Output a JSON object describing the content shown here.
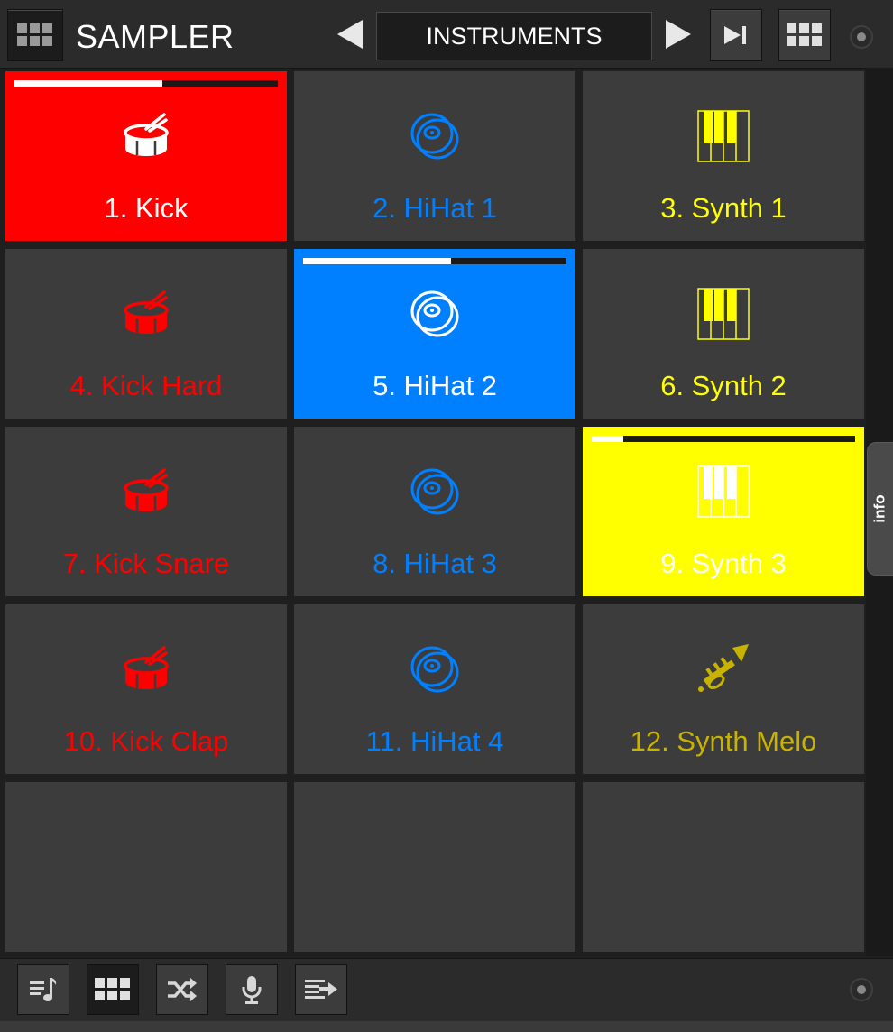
{
  "header": {
    "title": "SAMPLER",
    "preset": "INSTRUMENTS"
  },
  "colors": {
    "red": "#ff0000",
    "blue": "#0080ff",
    "yellow": "#ffff00",
    "olive": "#c8b400",
    "pad_bg": "#3c3c3c"
  },
  "pads": [
    {
      "label": "1. Kick",
      "icon": "drum-icon",
      "color": "#ff0000",
      "active": true,
      "progress": 0.56
    },
    {
      "label": "2. HiHat 1",
      "icon": "cymbal-icon",
      "color": "#0080ff",
      "active": false
    },
    {
      "label": "3. Synth 1",
      "icon": "keyboard-icon",
      "color": "#ffff00",
      "active": false
    },
    {
      "label": "4. Kick Hard",
      "icon": "drum-icon",
      "color": "#ff0000",
      "active": false
    },
    {
      "label": "5. HiHat 2",
      "icon": "cymbal-icon",
      "color": "#0080ff",
      "active": true,
      "progress": 0.56
    },
    {
      "label": "6. Synth 2",
      "icon": "keyboard-icon",
      "color": "#ffff00",
      "active": false
    },
    {
      "label": "7. Kick Snare",
      "icon": "drum-icon",
      "color": "#ff0000",
      "active": false
    },
    {
      "label": "8. HiHat 3",
      "icon": "cymbal-icon",
      "color": "#0080ff",
      "active": false
    },
    {
      "label": "9. Synth 3",
      "icon": "keyboard-icon",
      "color": "#ffff00",
      "active": true,
      "progress": 0.12
    },
    {
      "label": "10. Kick Clap",
      "icon": "drum-icon",
      "color": "#ff0000",
      "active": false
    },
    {
      "label": "11. HiHat 4",
      "icon": "cymbal-icon",
      "color": "#0080ff",
      "active": false
    },
    {
      "label": "12. Synth Melo",
      "icon": "trumpet-icon",
      "color": "#c8b400",
      "active": false
    },
    {
      "label": "",
      "icon": "",
      "color": "",
      "active": false
    },
    {
      "label": "",
      "icon": "",
      "color": "",
      "active": false
    },
    {
      "label": "",
      "icon": "",
      "color": "",
      "active": false
    }
  ],
  "side_tab": "info",
  "footer": {
    "buttons": [
      "playlist-icon",
      "grid-icon",
      "shuffle-icon",
      "microphone-icon",
      "queue-icon"
    ]
  }
}
